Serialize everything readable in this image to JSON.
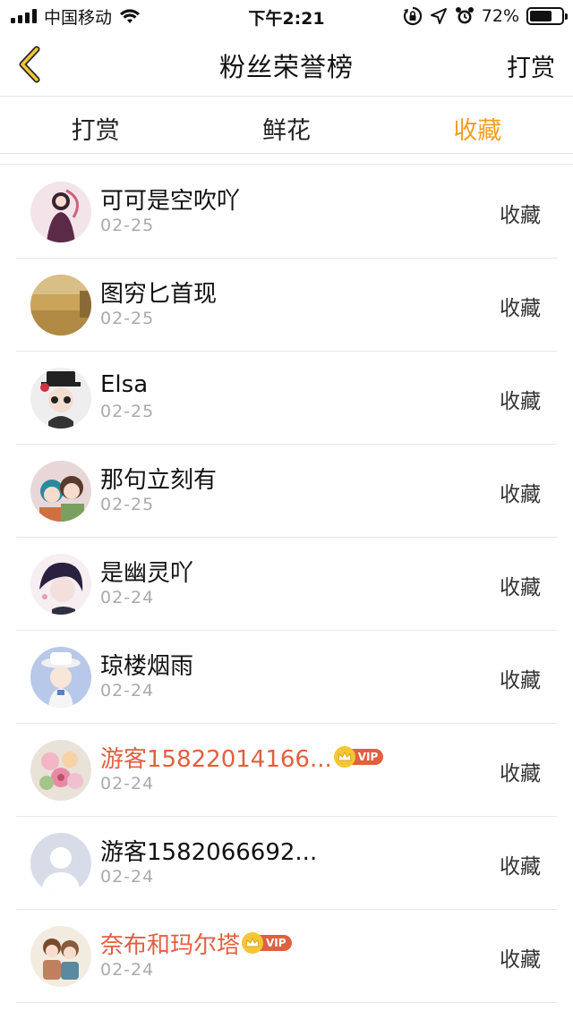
{
  "status_bar": {
    "carrier": "中国移动",
    "time": "下午2:21",
    "battery_percent": "72%",
    "battery_level": 0.72
  },
  "nav": {
    "title": "粉丝荣誉榜",
    "right_action": "打赏"
  },
  "tabs": [
    {
      "label": "打赏",
      "active": false
    },
    {
      "label": "鲜花",
      "active": false
    },
    {
      "label": "收藏",
      "active": true
    }
  ],
  "colors": {
    "accent": "#f0a020",
    "vip_name": "#e06040",
    "date": "#aaaaaa"
  },
  "rows": [
    {
      "name": "可可是空吹吖",
      "date": "02-25",
      "action": "收藏",
      "vip": false
    },
    {
      "name": "图穷匕首现",
      "date": "02-25",
      "action": "收藏",
      "vip": false
    },
    {
      "name": "Elsa",
      "date": "02-25",
      "action": "收藏",
      "vip": false
    },
    {
      "name": "那句立刻有",
      "date": "02-25",
      "action": "收藏",
      "vip": false
    },
    {
      "name": "是幽灵吖",
      "date": "02-24",
      "action": "收藏",
      "vip": false
    },
    {
      "name": "琼楼烟雨",
      "date": "02-24",
      "action": "收藏",
      "vip": false
    },
    {
      "name": "游客15822014166...",
      "date": "02-24",
      "action": "收藏",
      "vip": true,
      "vip_label": "VIP"
    },
    {
      "name": "游客1582066692...",
      "date": "02-24",
      "action": "收藏",
      "vip": false
    },
    {
      "name": "奈布和玛尔塔",
      "date": "02-24",
      "action": "收藏",
      "vip": true,
      "vip_label": "VIP"
    }
  ]
}
